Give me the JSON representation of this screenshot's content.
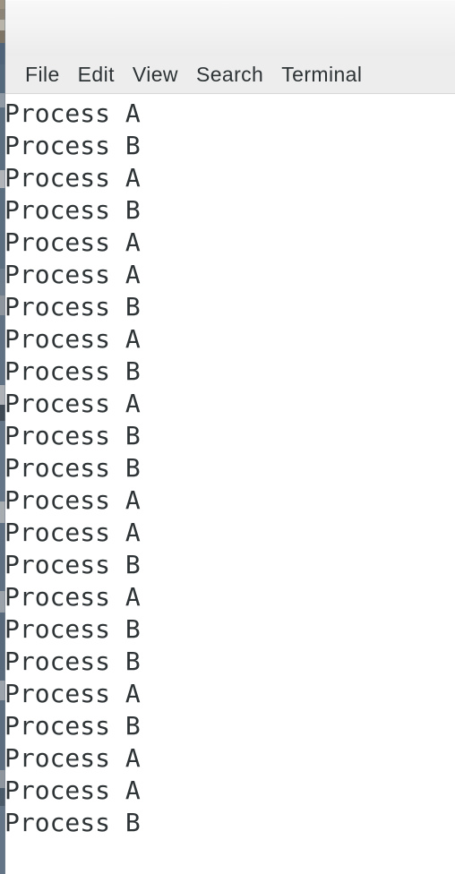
{
  "window": {
    "title": "",
    "background_color": "#ffffff",
    "text_color": "#2e3436",
    "titlebar_color": "#f2f2f2",
    "menubar_color": "#ededed"
  },
  "menu_bar": {
    "items": [
      {
        "label": "File"
      },
      {
        "label": "Edit"
      },
      {
        "label": "View"
      },
      {
        "label": "Search"
      },
      {
        "label": "Terminal"
      }
    ]
  },
  "terminal": {
    "lines": [
      "Process A",
      "Process B",
      "Process A",
      "Process B",
      "Process A",
      "Process A",
      "Process B",
      "Process A",
      "Process B",
      "Process A",
      "Process B",
      "Process B",
      "Process A",
      "Process A",
      "Process B",
      "Process A",
      "Process B",
      "Process B",
      "Process A",
      "Process B",
      "Process A",
      "Process A",
      "Process B"
    ]
  }
}
